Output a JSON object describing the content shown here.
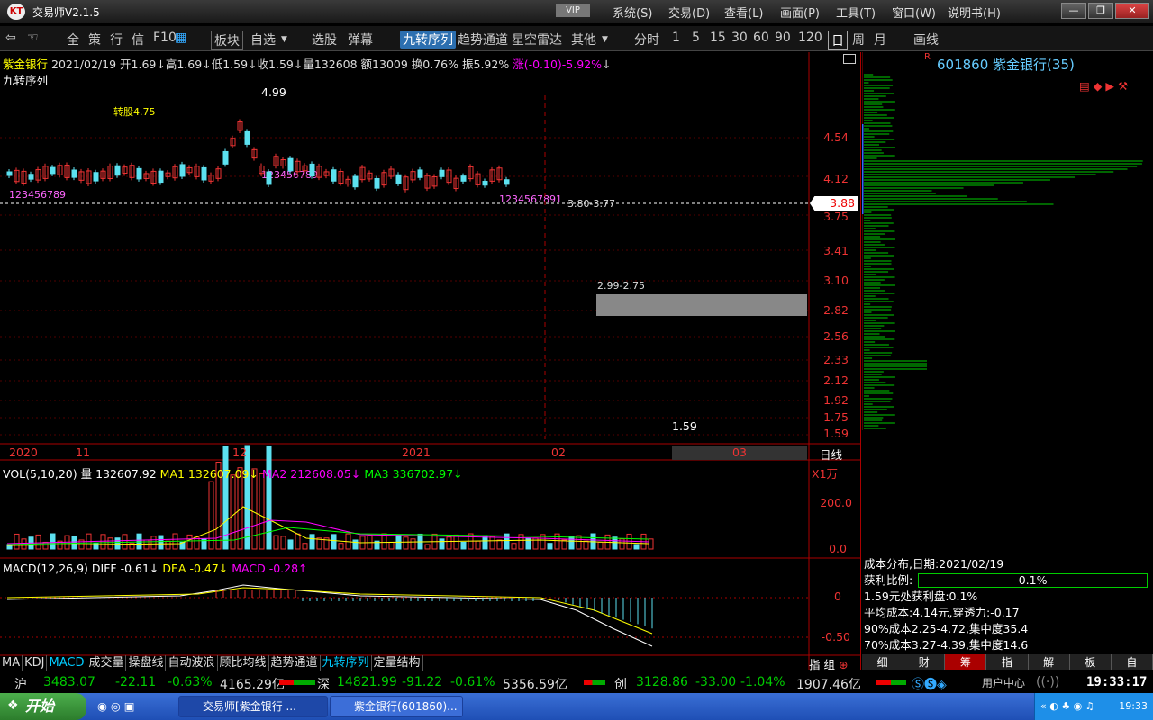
{
  "app": {
    "title": "交易师V2.1.5",
    "vip": "VIP",
    "menus": [
      "系统(S)",
      "交易(D)",
      "查看(L)",
      "画面(P)",
      "工具(T)",
      "窗口(W)",
      "说明书(H)"
    ]
  },
  "toolbar": {
    "items": [
      "全",
      "策",
      "行",
      "信",
      "F10",
      "板块",
      "自选",
      "选股",
      "弹幕",
      "九转序列",
      "趋势通道",
      "星空雷达",
      "其他",
      "分时",
      "1",
      "5",
      "15",
      "30",
      "60",
      "90",
      "120",
      "日",
      "周",
      "月",
      "画线"
    ]
  },
  "stock": {
    "name": "紫金银行",
    "date": "2021/02/19",
    "open": "开1.69",
    "high": "高1.69",
    "low": "低1.59",
    "close": "收1.59",
    "vol": "量132608",
    "amt": "额13009",
    "turn": "换0.76%",
    "amp": "振5.92%",
    "chg": "涨(-0.10)-5.92%"
  },
  "chart": {
    "indicator_label": "九转序列",
    "zhuangu": "转股4.75",
    "high_label": "4.99",
    "low_label": "1.59",
    "range1": "3.80-3.77",
    "range2": "2.99-2.75",
    "price_tag": "3.88",
    "nine_counts": [
      "123456789",
      "123456789",
      "1234567891"
    ],
    "price_axis": [
      "4.54",
      "4.12",
      "3.75",
      "3.41",
      "3.10",
      "2.82",
      "2.56",
      "2.33",
      "2.12",
      "1.92",
      "1.75",
      "1.59"
    ],
    "date_axis": [
      "2020",
      "11",
      "12",
      "2021",
      "02",
      "03"
    ],
    "period": "日线"
  },
  "vol": {
    "title": "VOL(5,10,20)",
    "vol": "量 132607.92",
    "ma1": "MA1 132607.09↓",
    "ma2": "MA2 212608.05↓",
    "ma3": "MA3 336702.97↓",
    "unit": "X1万",
    "axis": [
      "200.0",
      "0.0"
    ]
  },
  "macd": {
    "title": "MACD(12,26,9)",
    "diff": "DIFF -0.61↓",
    "dea": "DEA -0.47↓",
    "macd": "MACD -0.28↑",
    "axis": [
      "0",
      "-0.50"
    ]
  },
  "bottom_tabs": [
    "MA",
    "KDJ",
    "MACD",
    "成交量",
    "操盘线",
    "自动波浪",
    "顾比均线",
    "趋势通道",
    "九转序列",
    "定量结构"
  ],
  "bottom_right": [
    "指",
    "组"
  ],
  "right": {
    "code": "601860",
    "name": "紫金银行(35)",
    "r": "R"
  },
  "cost": {
    "title": "成本分布,日期:2021/02/19",
    "profit_label": "获利比例:",
    "profit_value": "0.1%",
    "lines": [
      "1.59元处获利盘:0.1%",
      "平均成本:4.14元,穿透力:-0.17",
      "90%成本2.25-4.72,集中度35.4",
      "70%成本3.27-4.39,集中度14.6"
    ],
    "tabs": [
      "细",
      "财",
      "筹",
      "指",
      "解",
      "板",
      "自"
    ]
  },
  "market": {
    "sh": {
      "label": "沪",
      "value": "3483.07",
      "chg": "-22.11",
      "pct": "-0.63%",
      "amt": "4165.29亿"
    },
    "sz": {
      "label": "深",
      "value": "14821.99",
      "chg": "-91.22",
      "pct": "-0.61%",
      "amt": "5356.59亿"
    },
    "cy": {
      "label": "创",
      "value": "3128.86",
      "chg": "-33.00",
      "pct": "-1.04%",
      "amt": "1907.46亿"
    },
    "user": "用户中心",
    "time": "19:33:17"
  },
  "taskbar": {
    "start": "开始",
    "tasks": [
      "交易师[紫金银行 ...",
      "紫金银行(601860)..."
    ],
    "clock": "19:33"
  }
}
